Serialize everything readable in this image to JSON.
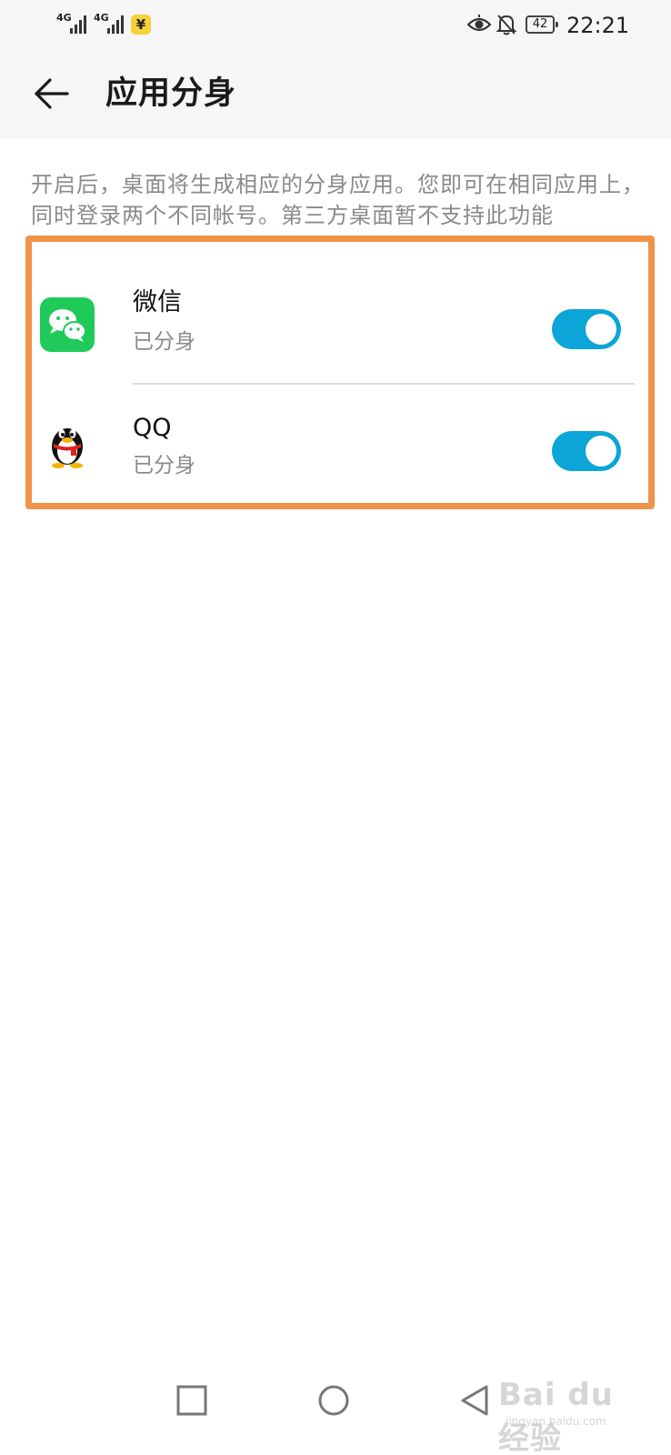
{
  "status_bar": {
    "network1": "4G",
    "network2": "4G",
    "pay_badge": "¥",
    "battery": "42",
    "time": "22:21"
  },
  "header": {
    "title": "应用分身"
  },
  "description": "开启后，桌面将生成相应的分身应用。您即可在相同应用上，同时登录两个不同帐号。第三方桌面暂不支持此功能",
  "apps": [
    {
      "name": "微信",
      "status": "已分身",
      "enabled": true,
      "icon": "wechat-icon"
    },
    {
      "name": "QQ",
      "status": "已分身",
      "enabled": true,
      "icon": "qq-penguin-icon"
    }
  ],
  "colors": {
    "highlight_border": "#f0924a",
    "toggle_on": "#0ba5d8",
    "wechat_green": "#1fca5a"
  },
  "watermark": {
    "main": "Bai du 经验",
    "sub": "jingyan.baidu.com"
  }
}
